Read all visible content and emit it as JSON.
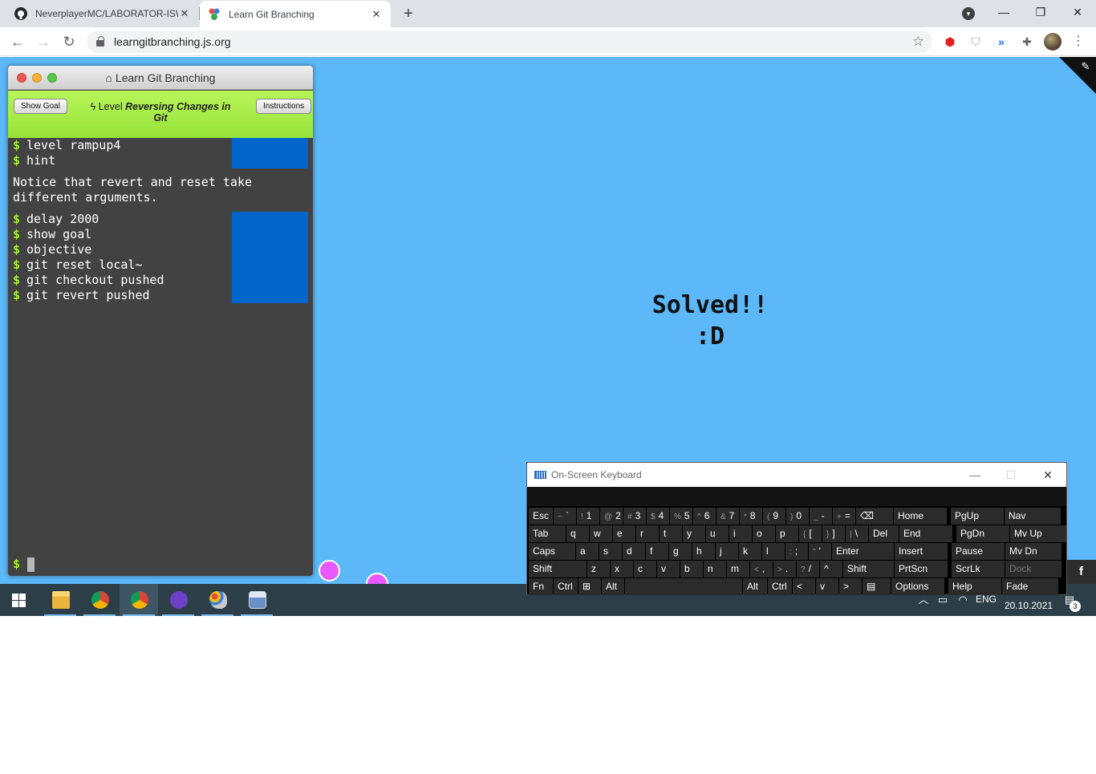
{
  "browser": {
    "tabs": [
      {
        "title": "NeverplayerMC/LABORATOR-ISW",
        "icon": "github-icon"
      },
      {
        "title": "Learn Git Branching",
        "icon": "git-branching-icon",
        "active": true
      }
    ],
    "url": "learngitbranching.js.org"
  },
  "terminal": {
    "title": "Learn Git Branching",
    "show_goal": "Show Goal",
    "instructions": "Instructions",
    "level_prefix": "Level",
    "level_name": "Reversing Changes in Git",
    "history_top": [
      {
        "text": "level rampup4"
      },
      {
        "text": "hint"
      }
    ],
    "hint_text": "Notice that revert and reset take different arguments.",
    "history_bottom": [
      {
        "text": "delay 2000"
      },
      {
        "text": "show goal"
      },
      {
        "text": "objective"
      },
      {
        "text": "git reset local~"
      },
      {
        "text": "git checkout pushed"
      },
      {
        "text": "git revert pushed"
      }
    ],
    "prompt": "$"
  },
  "main": {
    "solved_line1": "Solved!!",
    "solved_line2": ":D"
  },
  "osk": {
    "title": "On-Screen Keyboard",
    "rows": [
      [
        "Esc",
        "~ `",
        "! 1",
        "@ 2",
        "# 3",
        "$ 4",
        "% 5",
        "^ 6",
        "& 7",
        "* 8",
        "( 9",
        ") 0",
        "_ -",
        "+ =",
        "⌫",
        "Home",
        "PgUp",
        "Nav"
      ],
      [
        "Tab",
        "q",
        "w",
        "e",
        "r",
        "t",
        "y",
        "u",
        "i",
        "o",
        "p",
        "{ [",
        "} ]",
        "| \\",
        "Del",
        "End",
        "PgDn",
        "Mv Up"
      ],
      [
        "Caps",
        "a",
        "s",
        "d",
        "f",
        "g",
        "h",
        "j",
        "k",
        "l",
        ": ;",
        "\" '",
        "Enter",
        "Insert",
        "Pause",
        "Mv Dn"
      ],
      [
        "Shift",
        "z",
        "x",
        "c",
        "v",
        "b",
        "n",
        "m",
        "< ,",
        "> .",
        "? /",
        "^",
        "Shift",
        "PrtScn",
        "ScrLk",
        "Dock"
      ],
      [
        "Fn",
        "Ctrl",
        "⊞",
        "Alt",
        "",
        "Alt",
        "Ctrl",
        "<",
        "v",
        ">",
        "▤",
        "Options",
        "Help",
        "Fade"
      ]
    ]
  },
  "taskbar": {
    "language": "ENG",
    "date": "20.10.2021",
    "notifications": "3",
    "facebook": "f"
  }
}
